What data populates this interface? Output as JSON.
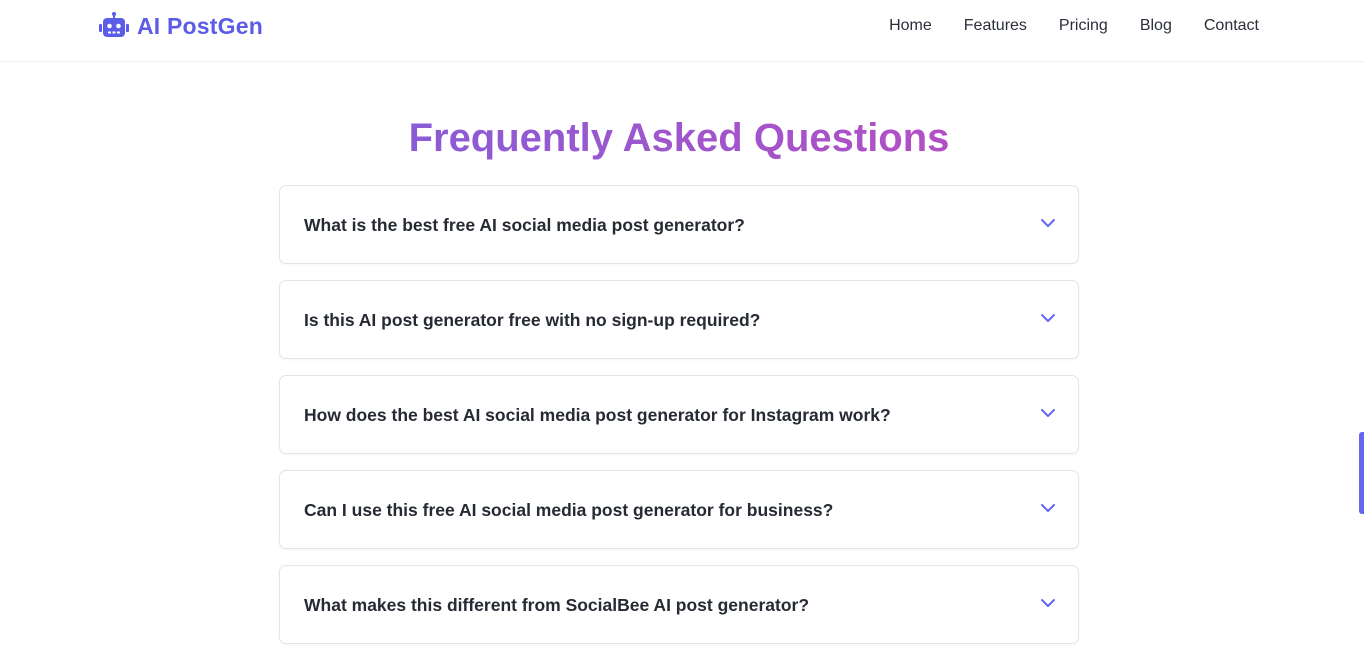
{
  "header": {
    "logo_icon": "robot-icon",
    "logo_text": "AI PostGen",
    "nav": [
      {
        "label": "Home"
      },
      {
        "label": "Features"
      },
      {
        "label": "Pricing"
      },
      {
        "label": "Blog"
      },
      {
        "label": "Contact"
      }
    ]
  },
  "faq": {
    "title": "Frequently Asked Questions",
    "toggle_icon": "chevron-down-icon",
    "items": [
      {
        "question": "What is the best free AI social media post generator?"
      },
      {
        "question": "Is this AI post generator free with no sign-up required?"
      },
      {
        "question": "How does the best AI social media post generator for Instagram work?"
      },
      {
        "question": "Can I use this free AI social media post generator for business?"
      },
      {
        "question": "What makes this different from SocialBee AI post generator?"
      }
    ]
  },
  "colors": {
    "brand": "#5b5ce8",
    "title_gradient_start": "#8b5cd6",
    "title_gradient_end": "#b24fc4",
    "chevron": "#6366f1",
    "scrollbar": "#6366f1"
  }
}
